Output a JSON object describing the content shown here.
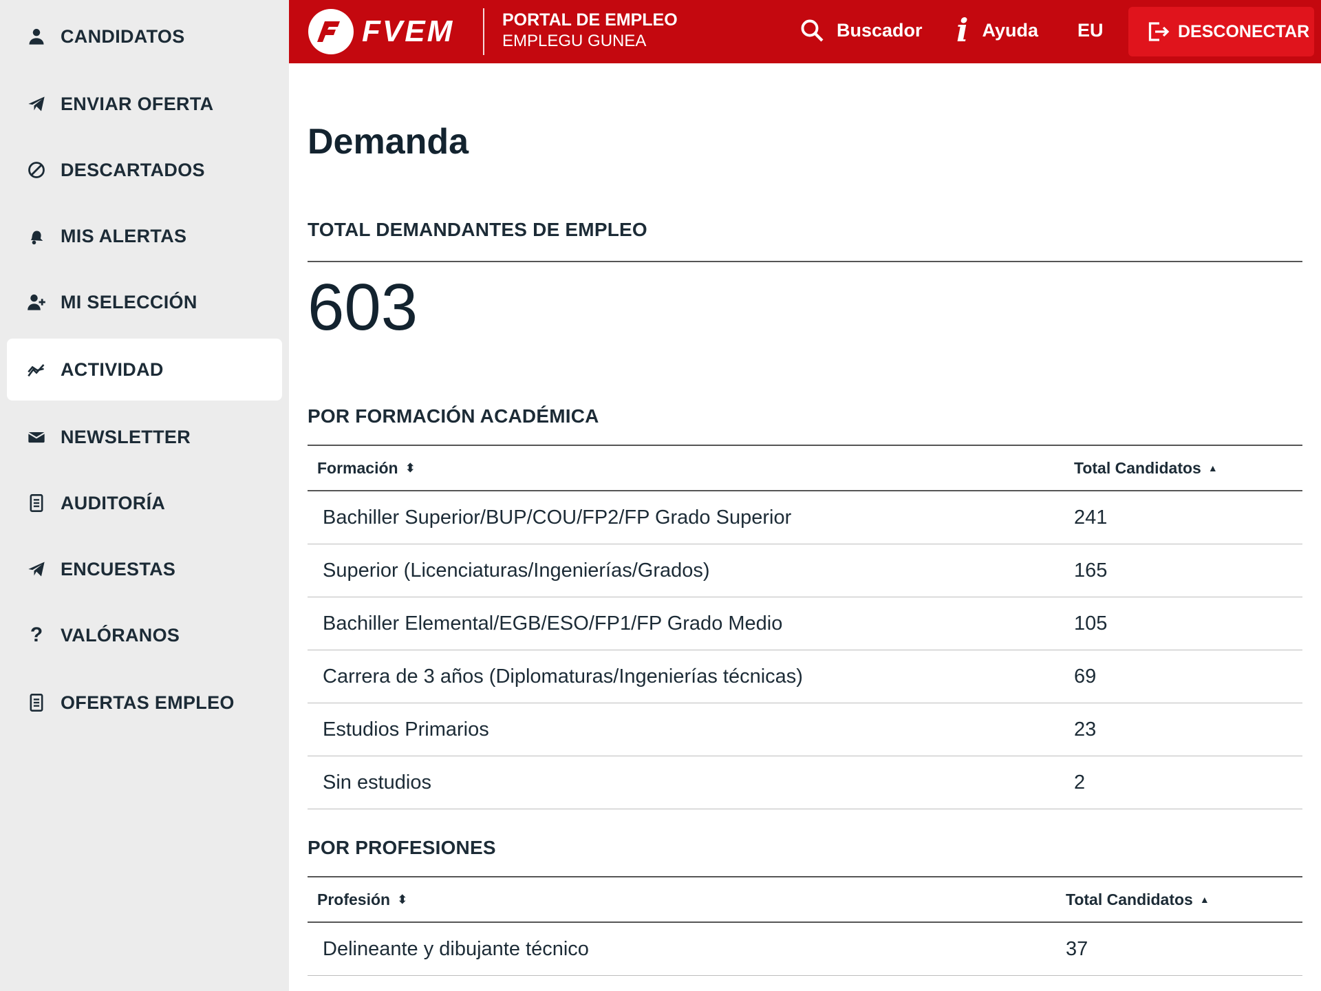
{
  "sidebar": {
    "items": [
      {
        "label": "CANDIDATOS",
        "icon": "user-icon"
      },
      {
        "label": "ENVIAR OFERTA",
        "icon": "send-icon"
      },
      {
        "label": "DESCARTADOS",
        "icon": "ban-icon"
      },
      {
        "label": "MIS ALERTAS",
        "icon": "bell-icon"
      },
      {
        "label": "MI SELECCIÓN",
        "icon": "user-plus-icon"
      },
      {
        "label": "ACTIVIDAD",
        "icon": "activity-chart-icon",
        "active": true
      },
      {
        "label": "NEWSLETTER",
        "icon": "envelope-icon"
      },
      {
        "label": "AUDITORÍA",
        "icon": "document-icon"
      },
      {
        "label": "ENCUESTAS",
        "icon": "send-icon"
      },
      {
        "label": "VALÓRANOS",
        "icon": "question-icon"
      },
      {
        "label": "OFERTAS EMPLEO",
        "icon": "document-icon"
      }
    ]
  },
  "header": {
    "logo_text": "FVEM",
    "portal_line1": "PORTAL DE EMPLEO",
    "portal_line2": "EMPLEGU GUNEA",
    "search_label": "Buscador",
    "help_label": "Ayuda",
    "lang_label": "EU",
    "logout_label": "DESCONECTAR",
    "brand_color": "#c4080f",
    "logout_color": "#e0141c"
  },
  "main": {
    "title": "Demanda",
    "total_section_title": "TOTAL DEMANDANTES DE EMPLEO",
    "total_value": "603",
    "formacion": {
      "section_title": "POR FORMACIÓN ACADÉMICA",
      "col1": "Formación",
      "col2": "Total Candidatos",
      "rows": [
        {
          "name": "Bachiller Superior/BUP/COU/FP2/FP Grado Superior",
          "total": "241"
        },
        {
          "name": "Superior (Licenciaturas/Ingenierías/Grados)",
          "total": "165"
        },
        {
          "name": "Bachiller Elemental/EGB/ESO/FP1/FP Grado Medio",
          "total": "105"
        },
        {
          "name": "Carrera de 3 años (Diplomaturas/Ingenierías técnicas)",
          "total": "69"
        },
        {
          "name": "Estudios Primarios",
          "total": "23"
        },
        {
          "name": "Sin estudios",
          "total": "2"
        }
      ]
    },
    "profesiones": {
      "section_title": "POR PROFESIONES",
      "col1": "Profesión",
      "col2": "Total Candidatos",
      "rows": [
        {
          "name": "Delineante y dibujante técnico",
          "total": "37"
        }
      ]
    }
  }
}
